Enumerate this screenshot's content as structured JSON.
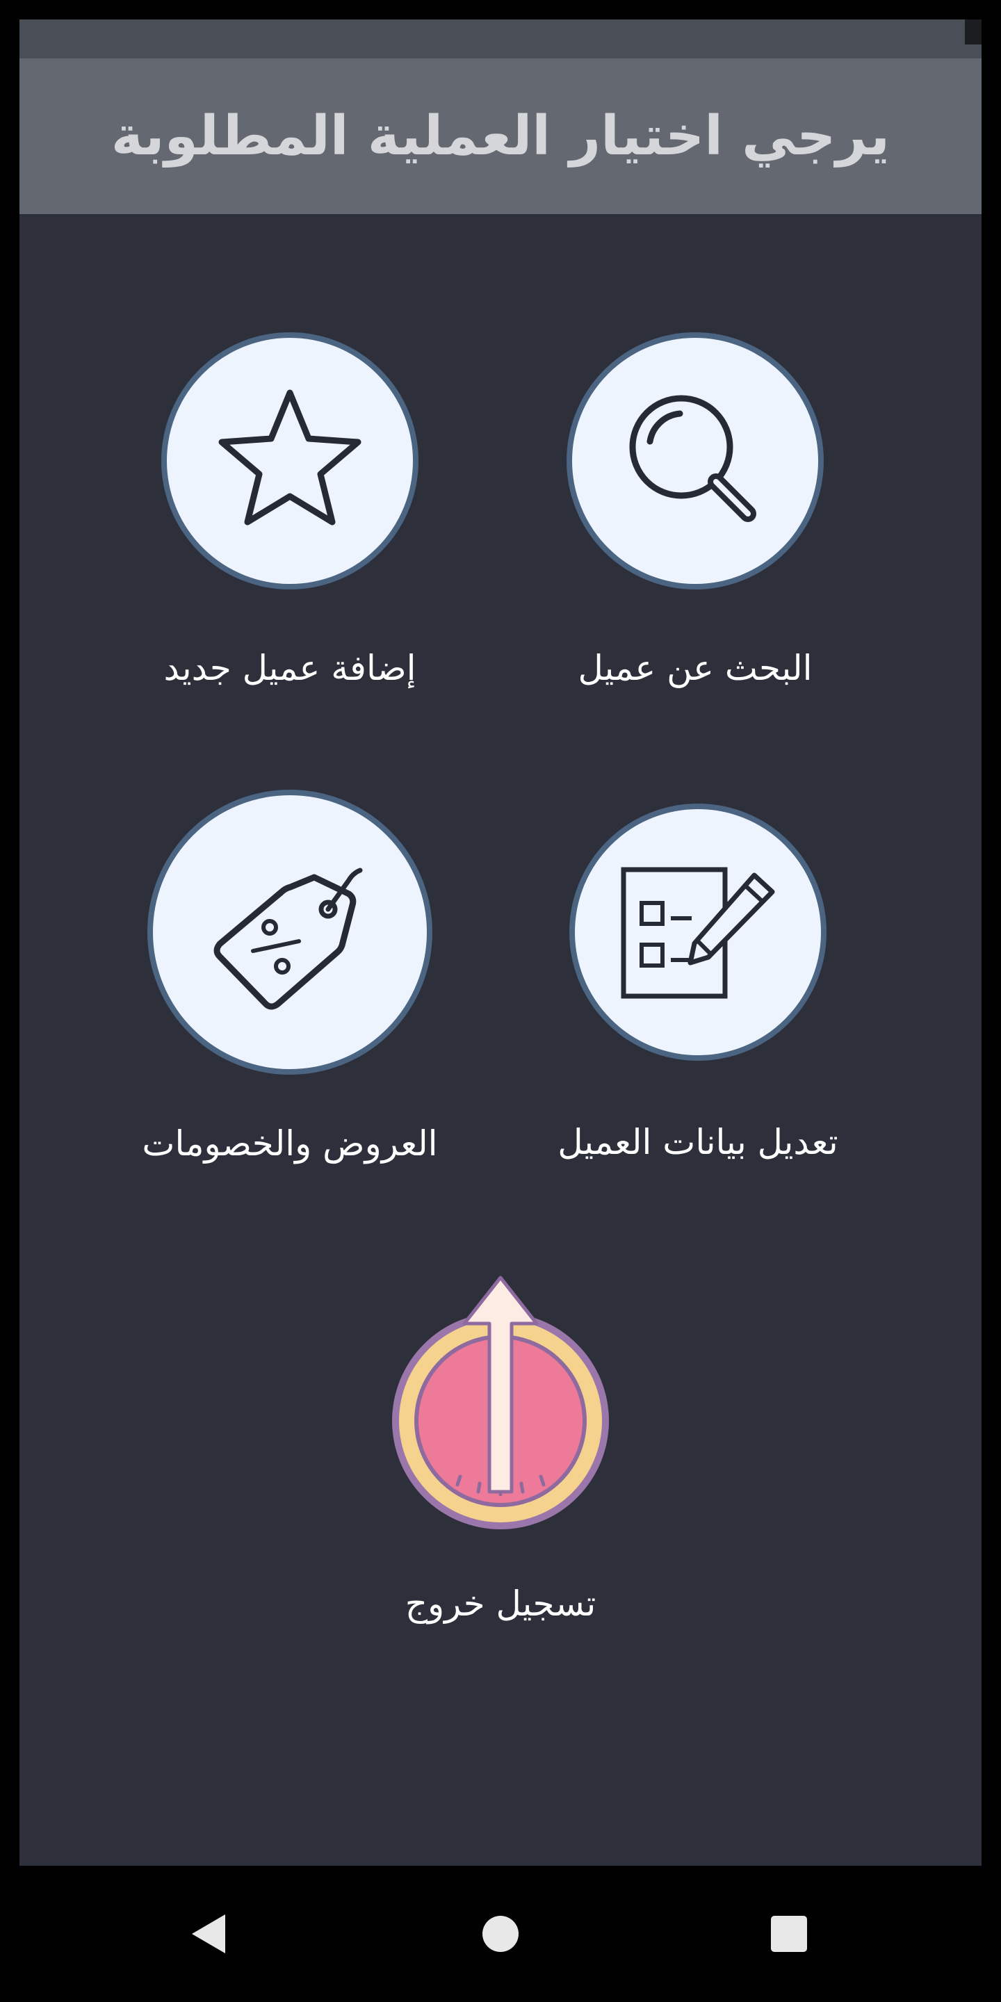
{
  "header": {
    "title": "يرجي اختيار العملية المطلوبة"
  },
  "menu": {
    "search_customer": {
      "label": "البحث عن عميل",
      "icon": "search-icon"
    },
    "add_customer": {
      "label": "إضافة عميل جديد",
      "icon": "star-icon"
    },
    "edit_customer": {
      "label": "تعديل بيانات العميل",
      "icon": "edit-form-icon"
    },
    "offers": {
      "label": "العروض والخصومات",
      "icon": "discount-tag-icon"
    },
    "logout": {
      "label": "تسجيل خروج",
      "icon": "power-icon"
    }
  },
  "navigation": {
    "back": "back-icon",
    "home": "home-icon",
    "recents": "recents-icon"
  },
  "colors": {
    "background": "#2d303b",
    "header": "#646871",
    "circle_fill": "#eef4fd",
    "circle_border": "#4b6482",
    "logout_fill": "#ee7a99",
    "logout_ring": "#f5d38e",
    "logout_outline": "#8e6a9f"
  }
}
